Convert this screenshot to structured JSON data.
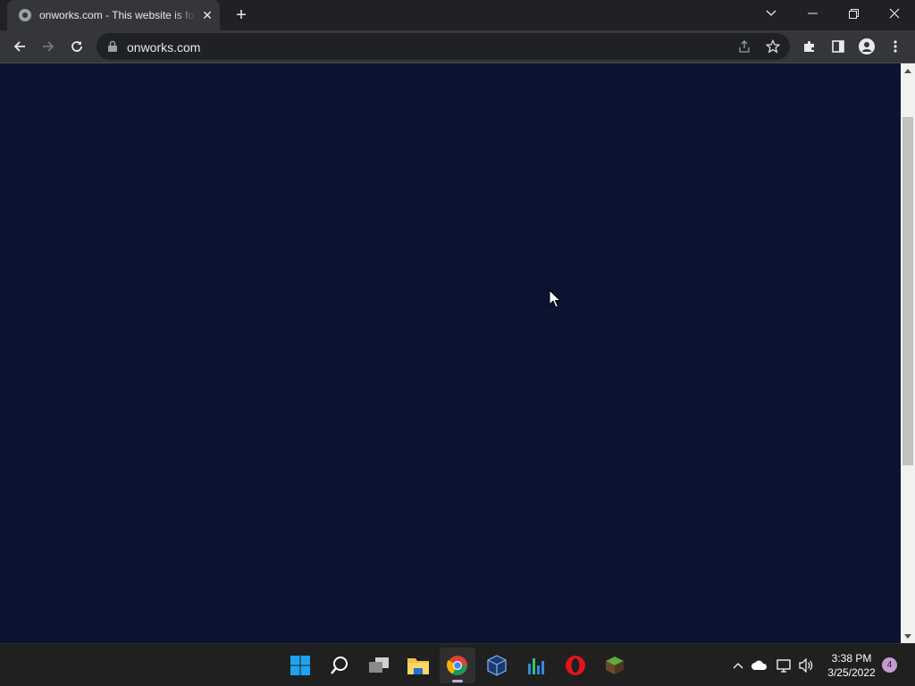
{
  "browser": {
    "tab": {
      "title": "onworks.com - This website is for sale"
    },
    "address_bar": {
      "url": "onworks.com"
    }
  },
  "page": {
    "background_color": "#0b1330"
  },
  "taskbar": {
    "apps": [
      "windows-start",
      "search",
      "task-view",
      "file-explorer",
      "chrome",
      "virtualbox",
      "app-store-bars",
      "opera",
      "minecraft"
    ],
    "active_app": "chrome",
    "clock": {
      "time": "3:38 PM",
      "date": "3/25/2022"
    },
    "notification_count": "4"
  },
  "colors": {
    "accent": "#c6a7e8",
    "chrome_dark": "#202124",
    "toolbar": "#35363a"
  }
}
